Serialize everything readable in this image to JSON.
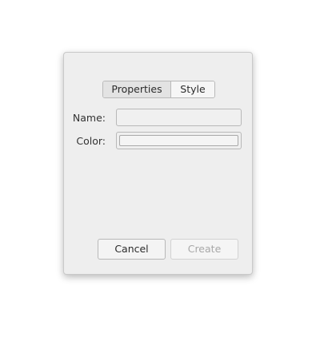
{
  "dialog": {
    "tabs": [
      {
        "label": "Properties",
        "active": true
      },
      {
        "label": "Style",
        "active": false
      }
    ],
    "fields": {
      "name_label": "Name:",
      "name_value": "",
      "color_label": "Color:"
    },
    "buttons": {
      "cancel_label": "Cancel",
      "create_label": "Create",
      "create_enabled": false
    }
  }
}
